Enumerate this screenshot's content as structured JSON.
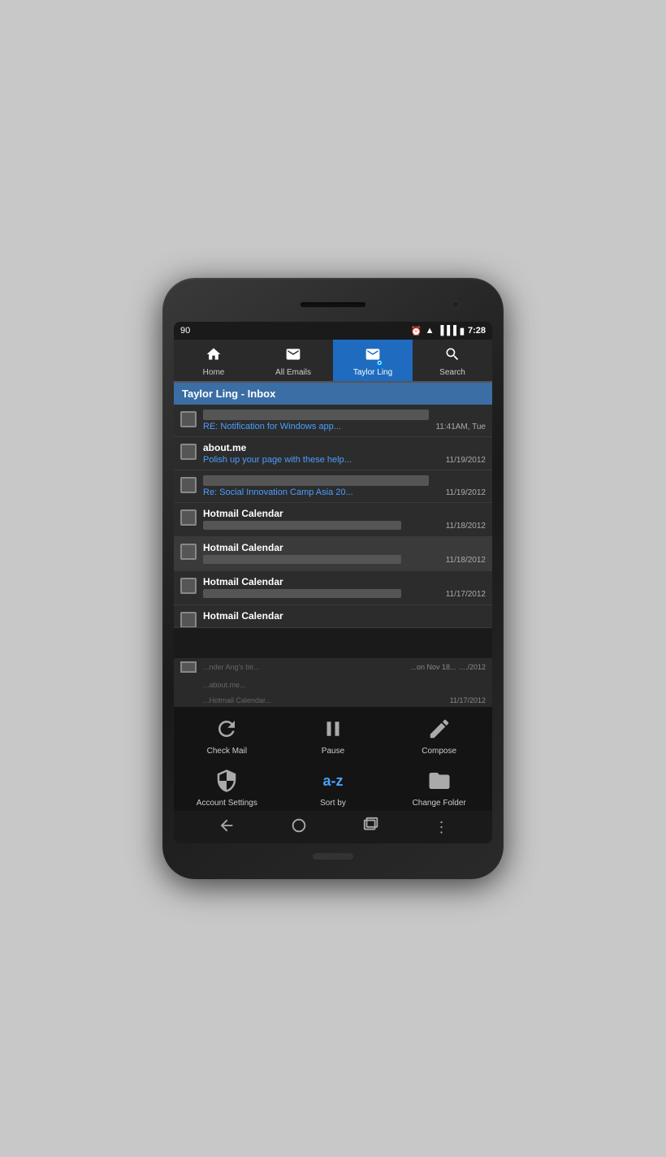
{
  "phone": {
    "status_bar": {
      "left": "90",
      "time": "7:28",
      "icons": [
        "alarm",
        "wifi",
        "signal",
        "battery"
      ]
    },
    "tabs": [
      {
        "id": "home",
        "label": "Home",
        "icon": "home",
        "active": false
      },
      {
        "id": "all-emails",
        "label": "All Emails",
        "icon": "email",
        "active": false
      },
      {
        "id": "taylor-ling",
        "label": "Taylor Ling",
        "icon": "outlook",
        "active": true
      },
      {
        "id": "search",
        "label": "Search",
        "icon": "search",
        "active": false
      }
    ],
    "inbox": {
      "title": "Taylor Ling - Inbox",
      "emails": [
        {
          "id": 1,
          "sender_blurred": true,
          "sender": "RE: Notification for Windows app...",
          "subject": "RE: Notification for Windows app...",
          "date": "11:41AM, Tue",
          "checked": false
        },
        {
          "id": 2,
          "sender_blurred": false,
          "sender": "about.me",
          "subject": "Polish up your page with these help...",
          "date": "11/19/2012",
          "checked": false
        },
        {
          "id": 3,
          "sender_blurred": true,
          "sender": "",
          "subject": "Re: Social Innovation Camp Asia 20...",
          "date": "11/19/2012",
          "checked": false
        },
        {
          "id": 4,
          "sender_blurred": false,
          "sender": "Hotmail Calendar",
          "subject": "",
          "subject_blurred": true,
          "date": "11/18/2012",
          "checked": false
        },
        {
          "id": 5,
          "sender_blurred": false,
          "sender": "Hotmail Calendar",
          "subject": "",
          "subject_blurred": true,
          "date": "11/18/2012",
          "checked": false,
          "highlighted": true
        },
        {
          "id": 6,
          "sender_blurred": false,
          "sender": "Hotmail Calendar",
          "subject": "",
          "subject_blurred": true,
          "date": "11/17/2012",
          "checked": false
        },
        {
          "id": 7,
          "sender_blurred": false,
          "sender": "Hotmail Calendar",
          "subject": "",
          "subject_blurred": true,
          "date": "",
          "checked": false,
          "partial": true
        }
      ]
    },
    "bottom_menu": {
      "row1": [
        {
          "id": "check-mail",
          "label": "Check Mail",
          "icon": "refresh"
        },
        {
          "id": "pause",
          "label": "Pause",
          "icon": "pause"
        },
        {
          "id": "compose",
          "label": "Compose",
          "icon": "compose"
        }
      ],
      "row2": [
        {
          "id": "account-settings",
          "label": "Account Settings",
          "icon": "settings"
        },
        {
          "id": "sort-by",
          "label": "Sort by",
          "icon": "az"
        },
        {
          "id": "change-folder",
          "label": "Change Folder",
          "icon": "folder"
        }
      ]
    },
    "android_nav": {
      "back": "←",
      "home": "⬡",
      "recents": "▭",
      "menu": "⋮"
    }
  }
}
